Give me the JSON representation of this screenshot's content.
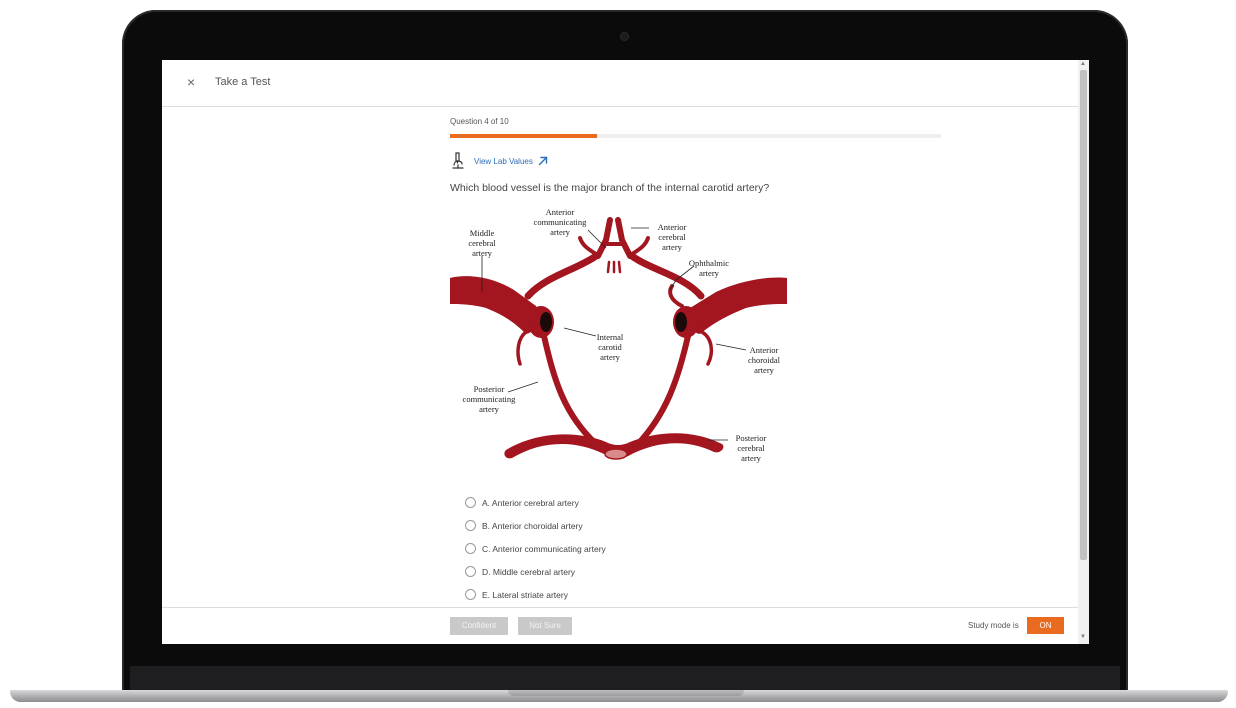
{
  "header": {
    "close_symbol": "×",
    "title": "Take a Test"
  },
  "question": {
    "counter": "Question 4 of 10",
    "progress_fraction": 0.3,
    "lab_values_link": "View Lab Values",
    "text": "Which blood vessel is the major branch of the internal carotid artery?"
  },
  "diagram": {
    "anterior_communicating": [
      "Anterior",
      "communicating",
      "artery"
    ],
    "anterior_cerebral": [
      "Anterior",
      "cerebral",
      "artery"
    ],
    "middle_cerebral": [
      "Middle",
      "cerebral",
      "artery"
    ],
    "ophthalmic": [
      "Ophthalmic",
      "artery"
    ],
    "internal_carotid": [
      "Internal",
      "carotid",
      "artery"
    ],
    "anterior_choroidal": [
      "Anterior",
      "choroidal",
      "artery"
    ],
    "posterior_communicating": [
      "Posterior",
      "communicating",
      "artery"
    ],
    "posterior_cerebral": [
      "Posterior",
      "cerebral",
      "artery"
    ]
  },
  "options": [
    {
      "label": "A. Anterior cerebral artery"
    },
    {
      "label": "B. Anterior choroidal artery"
    },
    {
      "label": "C. Anterior communicating artery"
    },
    {
      "label": "D. Middle cerebral artery"
    },
    {
      "label": "E. Lateral striate artery"
    }
  ],
  "footer": {
    "confident_label": "Confident",
    "not_sure_label": "Not Sure",
    "study_mode_label": "Study mode is",
    "study_mode_value": "ON"
  },
  "colors": {
    "accent": "#e86b1f",
    "artery": "#a3151f",
    "link": "#2a6ebb",
    "button_disabled": "#c9c9c9"
  },
  "icons": {
    "close": "close-icon",
    "lab": "microscope-icon",
    "external": "external-link-icon"
  }
}
